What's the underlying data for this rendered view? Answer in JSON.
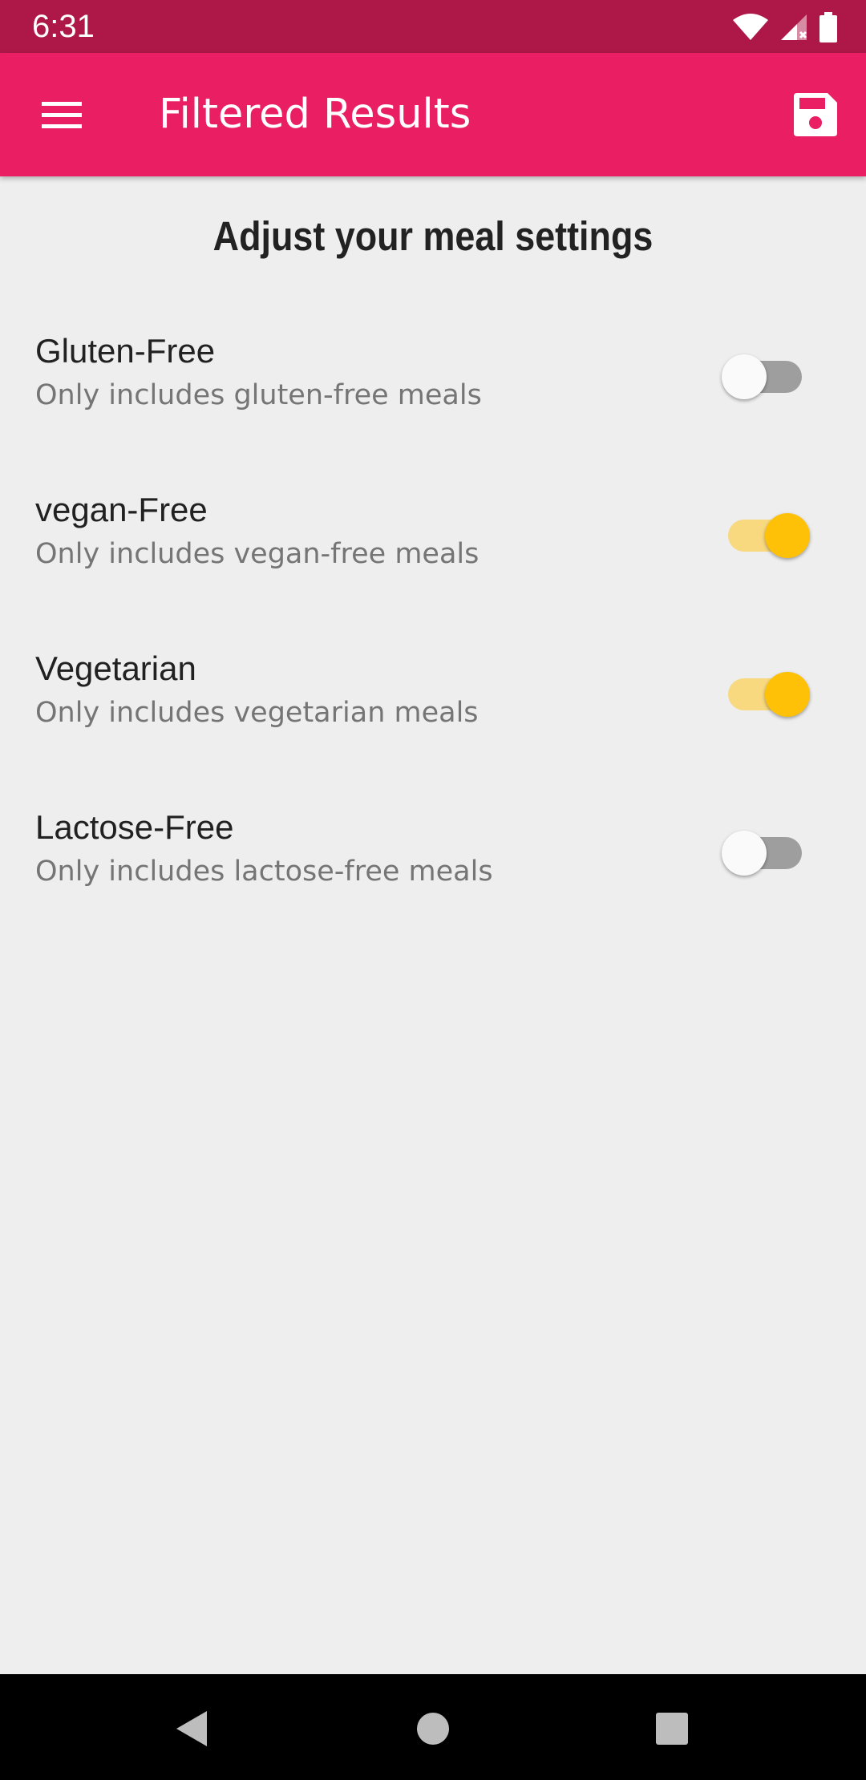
{
  "status_bar": {
    "time": "6:31",
    "icons": [
      "wifi-icon",
      "cell-signal-icon",
      "battery-icon"
    ]
  },
  "app_bar": {
    "title": "Filtered Results",
    "menu_icon": "hamburger-menu-icon",
    "save_icon": "save-floppy-icon",
    "color": "#e91e63",
    "status_color": "#ad1849"
  },
  "main": {
    "heading": "Adjust your meal settings",
    "settings": [
      {
        "label": "Gluten-Free",
        "description": "Only includes gluten-free meals",
        "enabled": false
      },
      {
        "label": "vegan-Free",
        "description": "Only includes vegan-free meals",
        "enabled": true
      },
      {
        "label": "Vegetarian",
        "description": "Only includes vegetarian meals",
        "enabled": true
      },
      {
        "label": "Lactose-Free",
        "description": "Only includes lactose-free meals",
        "enabled": false
      }
    ],
    "switch_on_color": "#ffc107",
    "switch_off_color": "#9e9e9e"
  },
  "nav_bar": {
    "buttons": [
      "back-icon",
      "home-icon",
      "recents-icon"
    ]
  }
}
